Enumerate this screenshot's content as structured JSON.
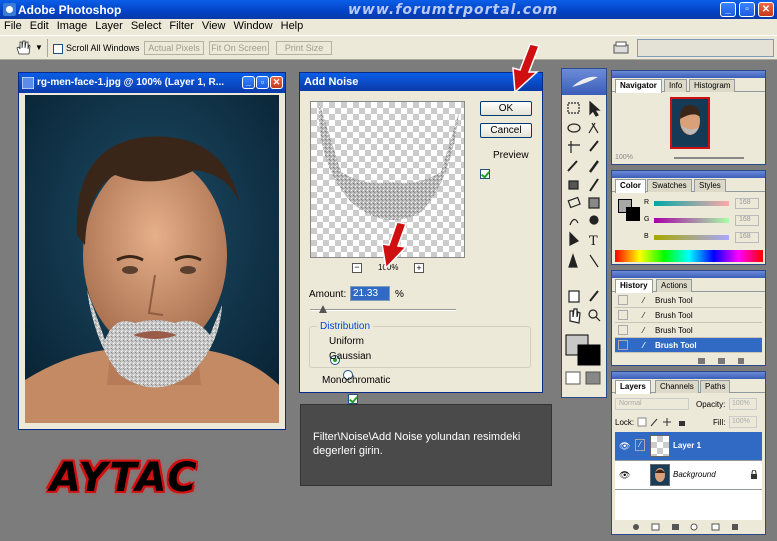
{
  "app": {
    "title": "Adobe Photoshop",
    "watermark": "www.forumtrportal.com",
    "window_buttons": {
      "minimize": "_",
      "restore": "▫",
      "close": "✕"
    }
  },
  "menu": [
    "File",
    "Edit",
    "Image",
    "Layer",
    "Select",
    "Filter",
    "View",
    "Window",
    "Help"
  ],
  "options_bar": {
    "scroll_all_label": "Scroll All Windows",
    "buttons": [
      "Actual Pixels",
      "Fit On Screen",
      "Print Size"
    ]
  },
  "document": {
    "title": "rg-men-face-1.jpg @ 100% (Layer 1, R..."
  },
  "dialog": {
    "title": "Add Noise",
    "ok_label": "OK",
    "cancel_label": "Cancel",
    "preview_label": "Preview",
    "preview_checked": true,
    "zoom_label": "100%",
    "zoom_out": "−",
    "zoom_in": "+",
    "amount_label": "Amount:",
    "amount_value": "21.33",
    "amount_unit": "%",
    "amount_slider_fraction": 0.09,
    "distribution_label": "Distribution",
    "uniform_label": "Uniform",
    "gaussian_label": "Gaussian",
    "distribution_selected": "Uniform",
    "monochromatic_label": "Monochromatic",
    "monochromatic_checked": true
  },
  "instruction": "Filter\\Noise\\Add Noise yolundan resimdeki degerleri girin.",
  "logo_text": "AYTAC",
  "navigator": {
    "tabs": [
      "Navigator",
      "Info",
      "Histogram"
    ],
    "zoom": "100%"
  },
  "color": {
    "tabs": [
      "Color",
      "Swatches",
      "Styles"
    ],
    "channels": [
      {
        "name": "R",
        "value": "168"
      },
      {
        "name": "G",
        "value": "168"
      },
      {
        "name": "B",
        "value": "168"
      }
    ]
  },
  "history": {
    "tabs": [
      "History",
      "Actions"
    ],
    "items": [
      "Brush Tool",
      "Brush Tool",
      "Brush Tool",
      "Brush Tool"
    ],
    "active_index": 3
  },
  "layers": {
    "tabs": [
      "Layers",
      "Channels",
      "Paths"
    ],
    "blend_mode": "Normal",
    "opacity_label": "Opacity:",
    "opacity": "100%",
    "lock_label": "Lock:",
    "fill_label": "Fill:",
    "fill": "100%",
    "items": [
      {
        "name": "Layer 1",
        "selected": true
      },
      {
        "name": "Background",
        "selected": false
      }
    ]
  },
  "colors": {
    "titlebar": "#0242c5",
    "selection": "#316ac5",
    "logo_red": "#d01010"
  }
}
